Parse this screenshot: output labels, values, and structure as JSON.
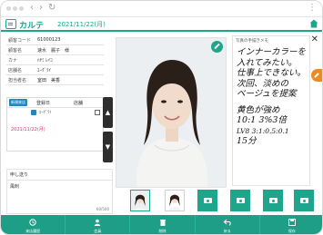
{
  "header": {
    "app_title": "カルテ",
    "date": "2021/11/22(月)"
  },
  "customer": {
    "rows": [
      {
        "label": "顧客コード",
        "value": "61000123"
      },
      {
        "label": "顧客名",
        "value": "速水　麗子　様"
      },
      {
        "label": "カナ",
        "value": "ﾊﾔﾐ ﾚｲｺ"
      },
      {
        "label": "店舗名",
        "value": "ｴｰｸﾞﾗｲ"
      },
      {
        "label": "担当者名",
        "value": "室田　美香"
      }
    ]
  },
  "visit": {
    "badge": "新規来店",
    "col_date": "登録日",
    "col_store": "店舗",
    "store_value": "ｴｰｸﾞﾗｲ",
    "date_link": "2021/11/22(月)"
  },
  "note": {
    "title": "申し送り",
    "body": "風刺",
    "count": "60/500"
  },
  "memo": {
    "title": "写真の手描きメモ",
    "lines": [
      "インナーカラーを",
      "入れてみたい。",
      "仕事上できない。",
      "次回、淡めの",
      "ベージュを提案",
      "",
      "黄色が強め",
      "10:1 3%3倍",
      "LV8 3:1:0.5:0.1",
      "15分"
    ]
  },
  "thumbnails": [
    {
      "state": "photo",
      "active": true
    },
    {
      "state": "photo",
      "active": false
    },
    {
      "state": "empty",
      "icon": "camera-icon"
    },
    {
      "state": "empty",
      "icon": "camera-icon"
    },
    {
      "state": "empty",
      "icon": "camera-icon"
    },
    {
      "state": "empty",
      "icon": "camera-icon"
    }
  ],
  "toolbar": {
    "items": [
      {
        "label": "来店履歴",
        "icon": "history-icon"
      },
      {
        "label": "会員",
        "icon": "member-icon"
      },
      {
        "label": "削除",
        "icon": "delete-icon"
      },
      {
        "label": "戻る",
        "icon": "back-icon"
      },
      {
        "label": "保存",
        "icon": "save-icon"
      }
    ]
  },
  "colors": {
    "accent": "#1fa58c",
    "toolbar": "#1e9e87",
    "edit_fab": "#1fa58c",
    "side_fab": "#ef8a1d",
    "date_link": "#d73a6a",
    "badge": "#1f88c0"
  }
}
